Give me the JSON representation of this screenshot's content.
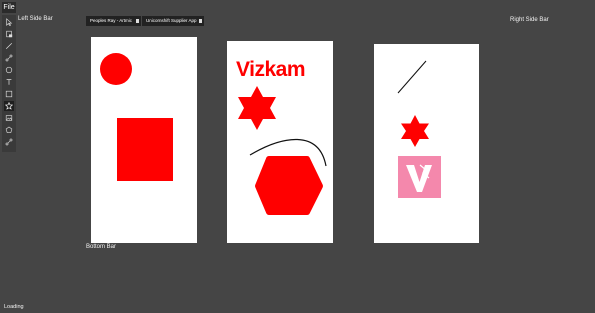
{
  "menu": {
    "file_label": "File"
  },
  "toolbar": {
    "tools": [
      {
        "icon": "cursor-icon"
      },
      {
        "icon": "frame-icon"
      },
      {
        "icon": "line-icon"
      },
      {
        "icon": "pen-icon"
      },
      {
        "icon": "ellipse-icon"
      },
      {
        "icon": "text-icon"
      },
      {
        "icon": "rectangle-icon"
      },
      {
        "icon": "star-icon"
      },
      {
        "icon": "image-icon"
      },
      {
        "icon": "polygon-icon"
      },
      {
        "icon": "path-icon"
      }
    ]
  },
  "panels": {
    "left_sidebar": "Left Side Bar",
    "right_sidebar": "Right Side Bar",
    "bottom_bar": "Bottom Bar"
  },
  "tabs": [
    {
      "label": "Peoples Ray - Artmic"
    },
    {
      "label": "Unicornshift Supplier App"
    }
  ],
  "artboards": {
    "middle": {
      "logo_text": "Vizkam"
    }
  },
  "status": {
    "text": "Loading"
  },
  "colors": {
    "accent": "#ff0000",
    "background": "#454545",
    "tile_pink": "#f488ac"
  }
}
